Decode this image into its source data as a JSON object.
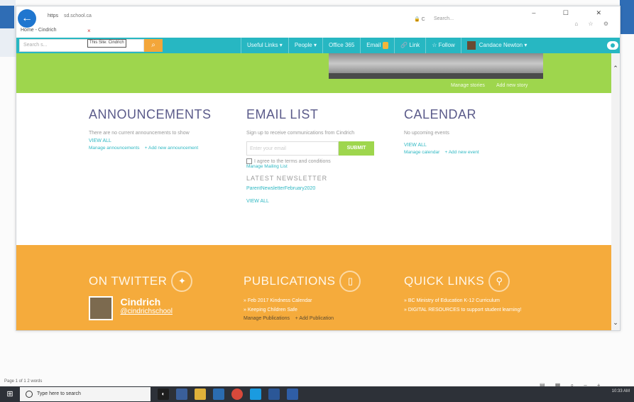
{
  "browser": {
    "url_scheme": "https",
    "url": "sd.school.ca",
    "url_extra": "",
    "tab_title": "Home - Cindrich",
    "search_placeholder": "Search...",
    "window_controls": "–  ☐  ✕"
  },
  "site_nav": {
    "search_placeholder": "Search s...",
    "search_scope": "This Site: Cindrich",
    "items": [
      "Useful Links ▾",
      "People ▾",
      "Office 365",
      "Email",
      "Link",
      "Follow",
      "Candace Newton ▾"
    ]
  },
  "hero": {
    "links": [
      "Manage stories",
      "Add new story"
    ]
  },
  "announcements": {
    "title": "ANNOUNCEMENTS",
    "text": "There are no current announcements to show",
    "view_all": "VIEW ALL",
    "manage": "Manage announcements",
    "add": "+ Add new announcement"
  },
  "email_list": {
    "title": "EMAIL LIST",
    "text": "Sign up to receive communications from Cindrich",
    "input_placeholder": "Enter your email",
    "submit": "SUBMIT",
    "agree": "I agree to the terms and conditions",
    "manage": "Manage Mailing List",
    "newsletter_title": "LATEST NEWSLETTER",
    "newsletter_link": "ParentNewsletterFebruary2020",
    "view_all": "VIEW ALL"
  },
  "calendar": {
    "title": "CALENDAR",
    "text": "No upcoming events",
    "view_all": "VIEW ALL",
    "manage": "Manage calendar",
    "add": "+ Add new event"
  },
  "footer": {
    "twitter": {
      "title": "ON TWITTER",
      "name": "Cindrich",
      "handle": "@cindrichschool"
    },
    "publications": {
      "title": "PUBLICATIONS",
      "items": [
        "Feb 2017 Kindness Calendar",
        "Keeping Children Safe"
      ],
      "manage": "Manage Publications",
      "add": "+ Add Publication"
    },
    "quick_links": {
      "title": "QUICK LINKS",
      "items": [
        "BC Ministry of Education K-12 Curriculum",
        "DIGITAL RESOURCES to support student learning!"
      ]
    }
  },
  "statusbar": {
    "left": "Page 1 of 1    2 words"
  },
  "taskbar": {
    "search_placeholder": "Type here to search",
    "time": "10:33 AM"
  },
  "colors": {
    "teal": "#27b7c2",
    "green": "#9ed64d",
    "orange": "#f5ab3c",
    "heading": "#5b5b8a"
  }
}
